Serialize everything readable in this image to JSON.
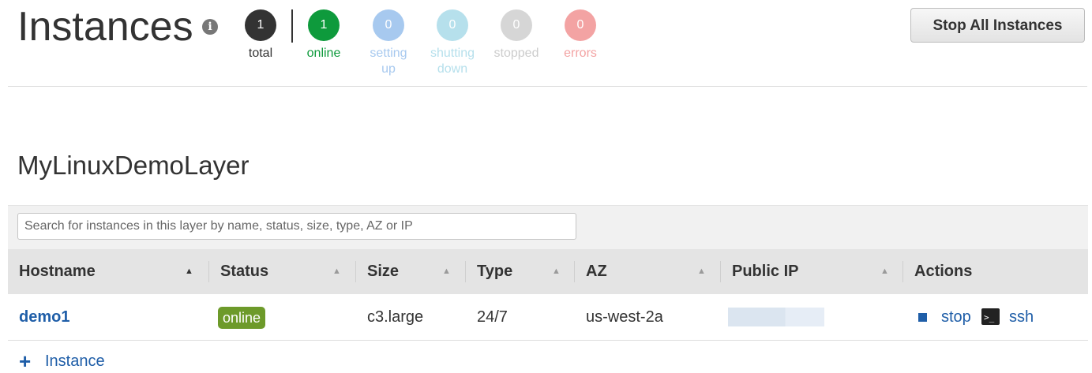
{
  "header": {
    "title": "Instances",
    "info_icon": "info-icon",
    "stop_all_label": "Stop All Instances",
    "counts": [
      {
        "value": "1",
        "label": "total",
        "label2": "",
        "color": "#333333",
        "label_color": "#333333"
      },
      {
        "value": "1",
        "label": "online",
        "label2": "",
        "color": "#0e9a3c",
        "label_color": "#0e9a3c"
      },
      {
        "value": "0",
        "label": "setting",
        "label2": "up",
        "color": "#a7c9ef",
        "label_color": "#a7c9ef"
      },
      {
        "value": "0",
        "label": "shutting",
        "label2": "down",
        "color": "#b6e0ec",
        "label_color": "#b6e0ec"
      },
      {
        "value": "0",
        "label": "stopped",
        "label2": "",
        "color": "#d6d6d6",
        "label_color": "#cccccc"
      },
      {
        "value": "0",
        "label": "errors",
        "label2": "",
        "color": "#f3a3a3",
        "label_color": "#f3a3a3"
      }
    ]
  },
  "layer": {
    "title": "MyLinuxDemoLayer",
    "search_placeholder": "Search for instances in this layer by name, status, size, type, AZ or IP",
    "columns": [
      {
        "label": "Hostname",
        "sort": "▲"
      },
      {
        "label": "Status",
        "sort": "▲"
      },
      {
        "label": "Size",
        "sort": "▲"
      },
      {
        "label": "Type",
        "sort": "▲"
      },
      {
        "label": "AZ",
        "sort": "▲"
      },
      {
        "label": "Public IP",
        "sort": "▲"
      },
      {
        "label": "Actions"
      }
    ],
    "rows": [
      {
        "hostname": "demo1",
        "status": "online",
        "size": "c3.large",
        "type": "24/7",
        "az": "us-west-2a",
        "public_ip": "",
        "actions": {
          "stop": "stop",
          "ssh": "ssh",
          "stop_icon": "stop-square-icon",
          "ssh_icon": "terminal-icon"
        }
      }
    ],
    "add_instance_icon": "plus-icon",
    "add_instance_label": "Instance"
  },
  "colors": {
    "link": "#1f5ea8",
    "online_badge": "#6d9a2a"
  }
}
